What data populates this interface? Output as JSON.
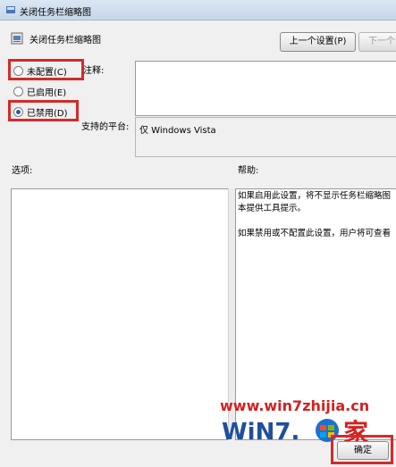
{
  "window": {
    "title": "关闭任务栏缩略图"
  },
  "header": {
    "title": "关闭任务栏缩略图",
    "prev_label": "上一个设置(P)",
    "next_label": "下一个"
  },
  "radios": [
    {
      "label": "未配置(C)",
      "checked": false
    },
    {
      "label": "已启用(E)",
      "checked": false
    },
    {
      "label": "已禁用(D)",
      "checked": true
    }
  ],
  "comment_label": "注释:",
  "platform_label": "支持的平台:",
  "platform_value": "仅 Windows Vista",
  "options_label": "选项:",
  "help_label": "帮助:",
  "help_text": [
    "如果启用此设置，将不显示任务栏缩略图",
    "本提供工具提示。",
    "如果禁用或不配置此设置，用户将可查看"
  ],
  "ok_label": "确定",
  "watermark": {
    "url": "www.win7zhijia.cn",
    "brand": "WiN7.",
    "brand_suffix": "家"
  },
  "colors": {
    "highlight": "#d42a2a",
    "selected": "#2a5aa8"
  }
}
